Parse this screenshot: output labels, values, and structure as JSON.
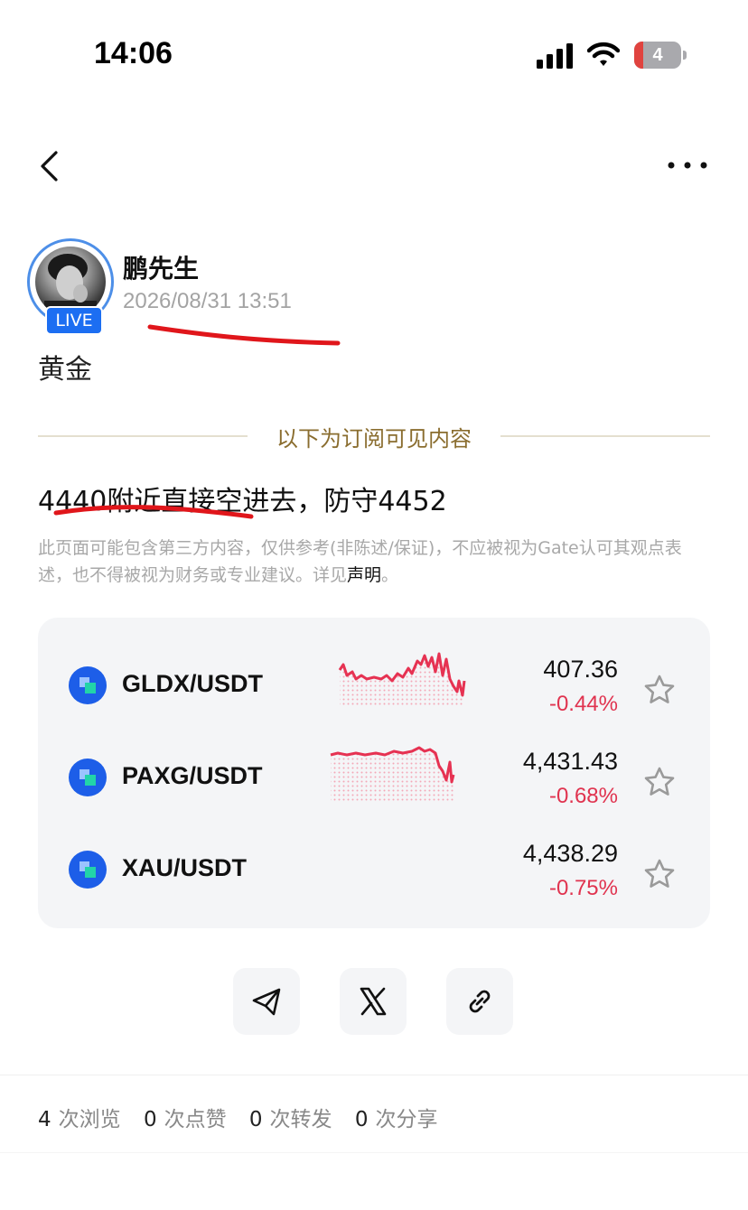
{
  "status_bar": {
    "time": "14:06",
    "battery": "4"
  },
  "post": {
    "author": "鹏先生",
    "live_badge": "LIVE",
    "date": "2026/08/31 13:51",
    "topic": "黄金",
    "subscription_label": "以下为订阅可见内容",
    "content": "4440附近直接空进去，防守4452",
    "disclaimer_text": "此页面可能包含第三方内容，仅供参考(非陈述/保证)，不应被视为Gate认可其观点表述，也不得被视为财务或专业建议。详见",
    "disclaimer_link": "声明",
    "disclaimer_end": "。"
  },
  "markets": [
    {
      "pair": "GLDX/USDT",
      "price": "407.36",
      "change": "-0.44%"
    },
    {
      "pair": "PAXG/USDT",
      "price": "4,431.43",
      "change": "-0.68%"
    },
    {
      "pair": "XAU/USDT",
      "price": "4,438.29",
      "change": "-0.75%"
    }
  ],
  "share": [
    "telegram-icon",
    "x-icon",
    "link-icon"
  ],
  "stats": {
    "views": "4",
    "views_label": "次浏览",
    "likes": "0",
    "likes_label": "次点赞",
    "reposts": "0",
    "reposts_label": "次转发",
    "shares": "0",
    "shares_label": "次分享"
  },
  "colors": {
    "down": "#e0334f",
    "live": "#1c6ef2",
    "subscription": "#8a6d2f"
  }
}
